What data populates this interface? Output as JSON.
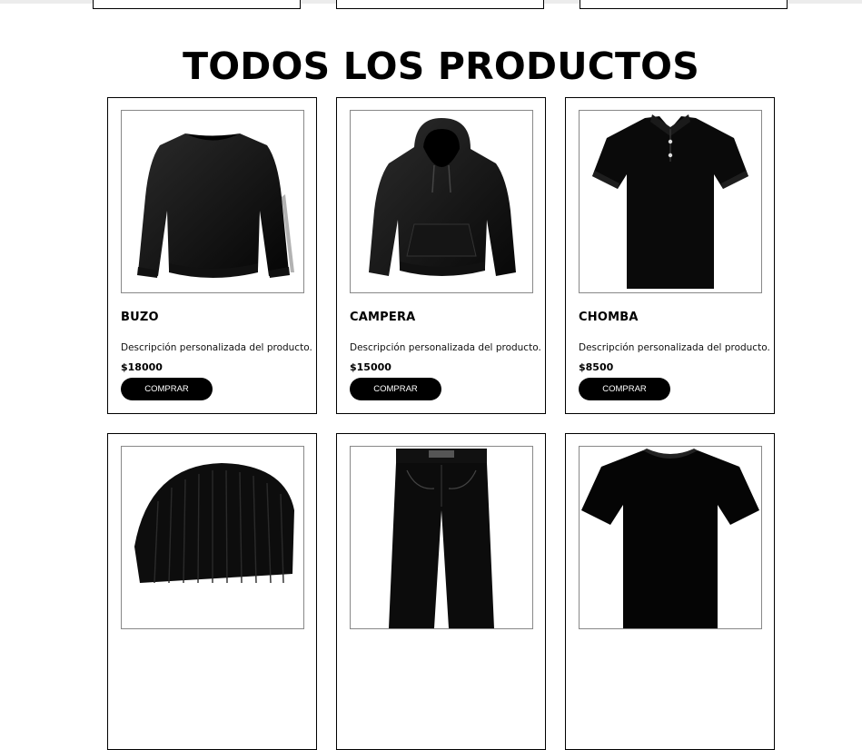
{
  "section": {
    "title": "TODOS LOS PRODUCTOS"
  },
  "products": [
    {
      "name": "BUZO",
      "description": "Descripción personalizada del producto.",
      "price": "$18000",
      "button": "COMPRAR",
      "icon": "sweatshirt-image"
    },
    {
      "name": "CAMPERA",
      "description": "Descripción personalizada del producto.",
      "price": "$15000",
      "button": "COMPRAR",
      "icon": "hoodie-image"
    },
    {
      "name": "CHOMBA",
      "description": "Descripción personalizada del producto.",
      "price": "$8500",
      "button": "COMPRAR",
      "icon": "polo-shirt-image"
    }
  ],
  "partial_products": [
    {
      "icon": "beanie-image"
    },
    {
      "icon": "jeans-image"
    },
    {
      "icon": "tshirt-image"
    }
  ],
  "colors": {
    "button_bg": "#000000",
    "button_text": "#ffffff",
    "border": "#000000"
  }
}
